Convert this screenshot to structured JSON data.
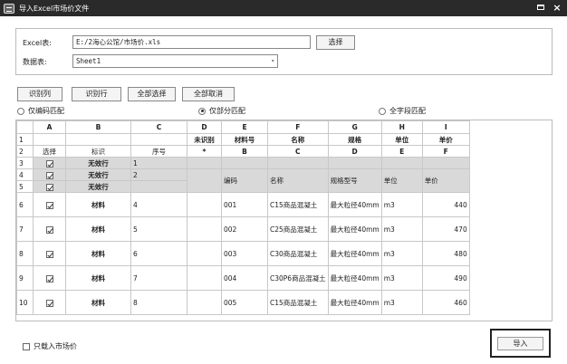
{
  "window": {
    "title": "导入Excel市场价文件",
    "minimize": "",
    "close": "×"
  },
  "file": {
    "excel_label": "Excel表:",
    "path": "E:/2海心公馆/市场价.xls",
    "browse_label": "选择",
    "sheet_label": "数据表:",
    "sheet_value": "Sheet1",
    "sheet_arrow": "▾"
  },
  "toolbar": {
    "identify_col": "识别列",
    "identify_row": "识别行",
    "select_all": "全部选择",
    "deselect_all": "全部取消"
  },
  "match": {
    "code_only": "仅编码匹配",
    "partial": "仅部分匹配",
    "all_fields": "全字段匹配",
    "selected": "partial"
  },
  "grid": {
    "col_letters": [
      "",
      "A",
      "B",
      "C",
      "D",
      "E",
      "F",
      "G",
      "H",
      "I"
    ],
    "row1": [
      "1",
      "",
      "",
      "",
      "未识别",
      "材料号",
      "名称",
      "规格",
      "单位",
      "单价"
    ],
    "row2": [
      "2",
      "选择",
      "标识",
      "序号",
      "*",
      "B",
      "C",
      "D",
      "E",
      "F"
    ],
    "invalid_rows": [
      {
        "no": "3",
        "flag": "无效行",
        "seq": "1"
      },
      {
        "no": "4",
        "flag": "无效行",
        "seq": "2"
      },
      {
        "no": "5",
        "flag": "无效行",
        "seq": ""
      }
    ],
    "header_in_data": {
      "code": "编码",
      "name": "名称",
      "spec": "规格型号",
      "unit": "单位",
      "price": "单价"
    },
    "rows": [
      {
        "no": "6",
        "flag": "材料",
        "seq": "4",
        "code": "001",
        "name": "C15商品混凝土",
        "spec": "最大粒径40mm",
        "unit": "m3",
        "price": "440"
      },
      {
        "no": "7",
        "flag": "材料",
        "seq": "5",
        "code": "002",
        "name": "C25商品混凝土",
        "spec": "最大粒径40mm",
        "unit": "m3",
        "price": "470"
      },
      {
        "no": "8",
        "flag": "材料",
        "seq": "6",
        "code": "003",
        "name": "C30商品混凝土",
        "spec": "最大粒径40mm",
        "unit": "m3",
        "price": "480"
      },
      {
        "no": "9",
        "flag": "材料",
        "seq": "7",
        "code": "004",
        "name": "C30P6商品混凝土",
        "spec": "最大粒径40mm",
        "unit": "m3",
        "price": "490"
      },
      {
        "no": "10",
        "flag": "材料",
        "seq": "8",
        "code": "005",
        "name": "C15商品混凝土",
        "spec": "最大粒径40mm",
        "unit": "m3",
        "price": "460"
      }
    ]
  },
  "footer": {
    "market_only": "只载入市场价",
    "import_label": "导入"
  }
}
